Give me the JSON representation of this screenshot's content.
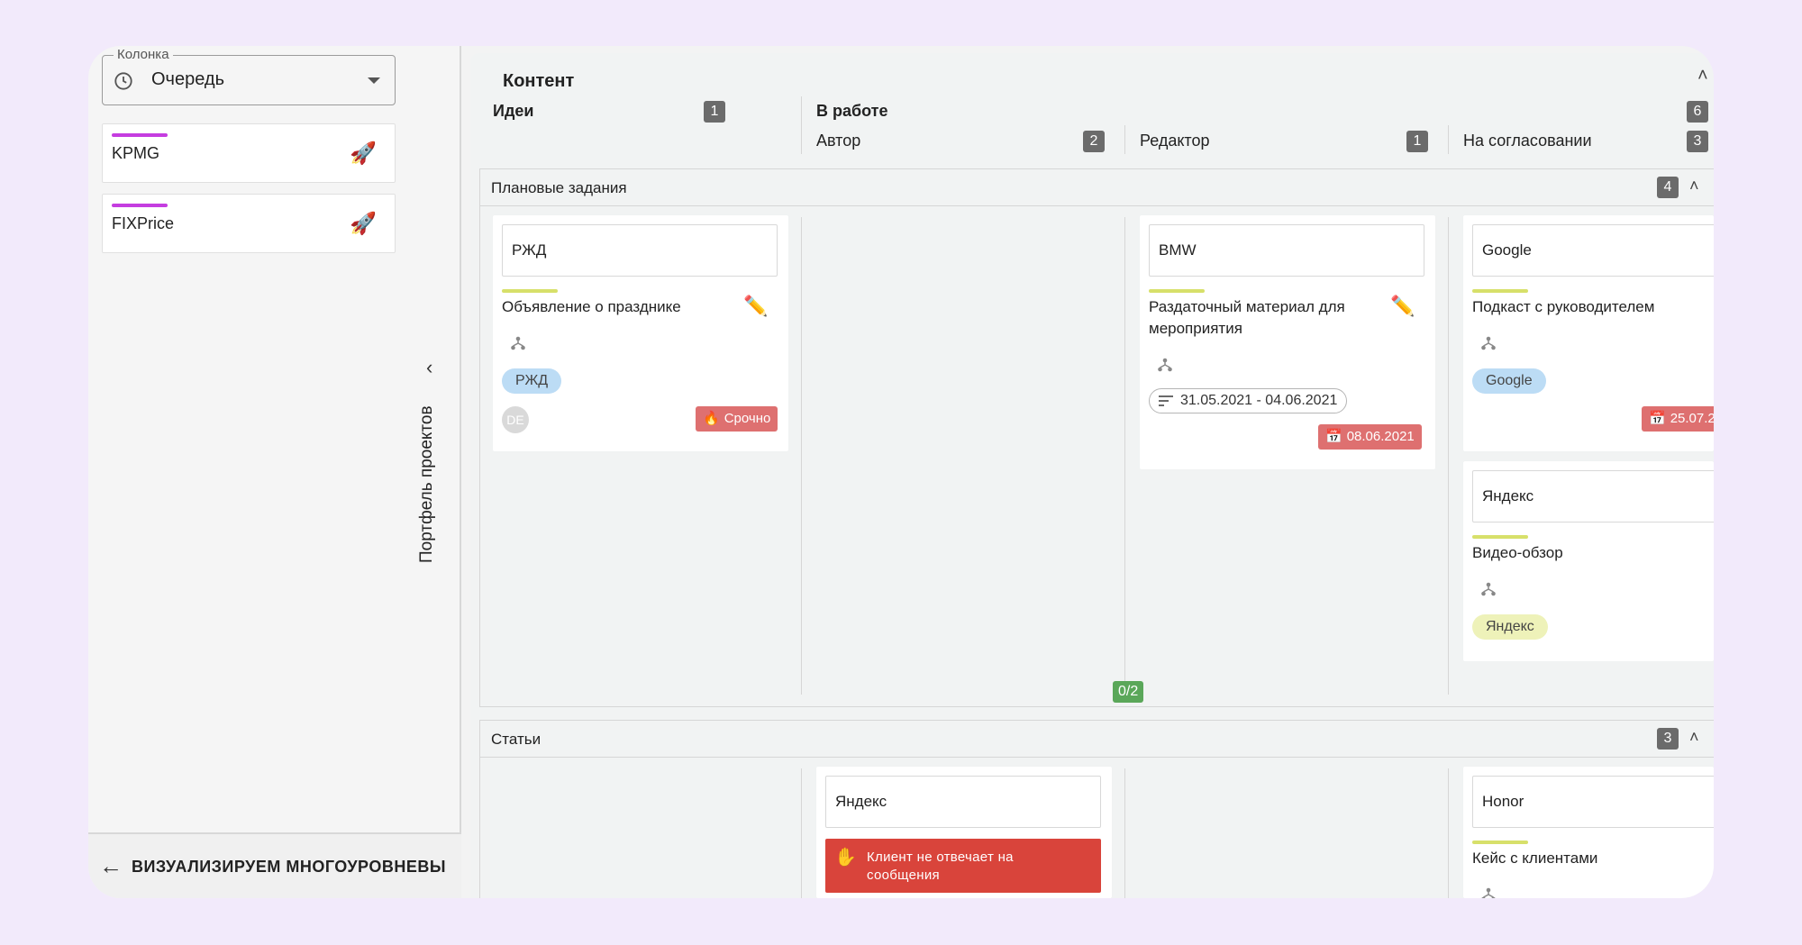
{
  "sidebar": {
    "column_select": {
      "legend": "Колонка",
      "value": "Очередь"
    },
    "projects": [
      {
        "name": "KPMG"
      },
      {
        "name": "FIXPrice"
      }
    ],
    "vertical_label": "Портфель проектов",
    "back_label": "ВИЗУАЛИЗИРУЕМ МНОГОУРОВНЕВЫ..."
  },
  "board": {
    "title": "Контент",
    "columns": {
      "ideas": {
        "label": "Идеи",
        "count": "1"
      },
      "in_work": {
        "label": "В работе",
        "count": "6"
      },
      "author": {
        "label": "Автор",
        "count": "2"
      },
      "editor": {
        "label": "Редактор",
        "count": "1"
      },
      "approval": {
        "label": "На согласовании",
        "count": "3"
      }
    },
    "lanes": [
      {
        "title": "Плановые задания",
        "count": "4"
      },
      {
        "title": "Статьи",
        "count": "3"
      }
    ],
    "wip_limit": "0/2",
    "cards": {
      "rzd": {
        "client": "РЖД",
        "task": "Объявление о празднике",
        "tag": "РЖД",
        "avatar": "DE",
        "urgent": "Срочно"
      },
      "bmw": {
        "client": "BMW",
        "task_line1": "Раздаточный материал для",
        "task_line2": "мероприятия",
        "date_range": "31.05.2021 - 04.06.2021",
        "due": "08.06.2021"
      },
      "google": {
        "client": "Google",
        "task": "Подкаст с руководителем",
        "tag": "Google",
        "due": "25.07.2"
      },
      "yandex1": {
        "client": "Яндекс",
        "task": "Видео-обзор",
        "tag": "Яндекс"
      },
      "yandex2": {
        "client": "Яндекс",
        "alert": "Клиент не отвечает на сообщения"
      },
      "honor": {
        "client": "Honor",
        "task": "Кейс с клиентами"
      }
    }
  },
  "colors": {
    "accent_purple": "#c53de0",
    "lime_bar": "#d7e06a",
    "urgent_red": "#de7070",
    "alert_red": "#d9443b",
    "wip_green": "#5aa759"
  },
  "icons": [
    "clock-icon",
    "chevron-down-icon",
    "rocket-icon",
    "arrow-left-icon",
    "chevron-left-icon",
    "chevron-up-icon",
    "pencil-icon",
    "hierarchy-icon",
    "fire-icon",
    "calendar-icon",
    "lines-icon",
    "hand-icon"
  ]
}
